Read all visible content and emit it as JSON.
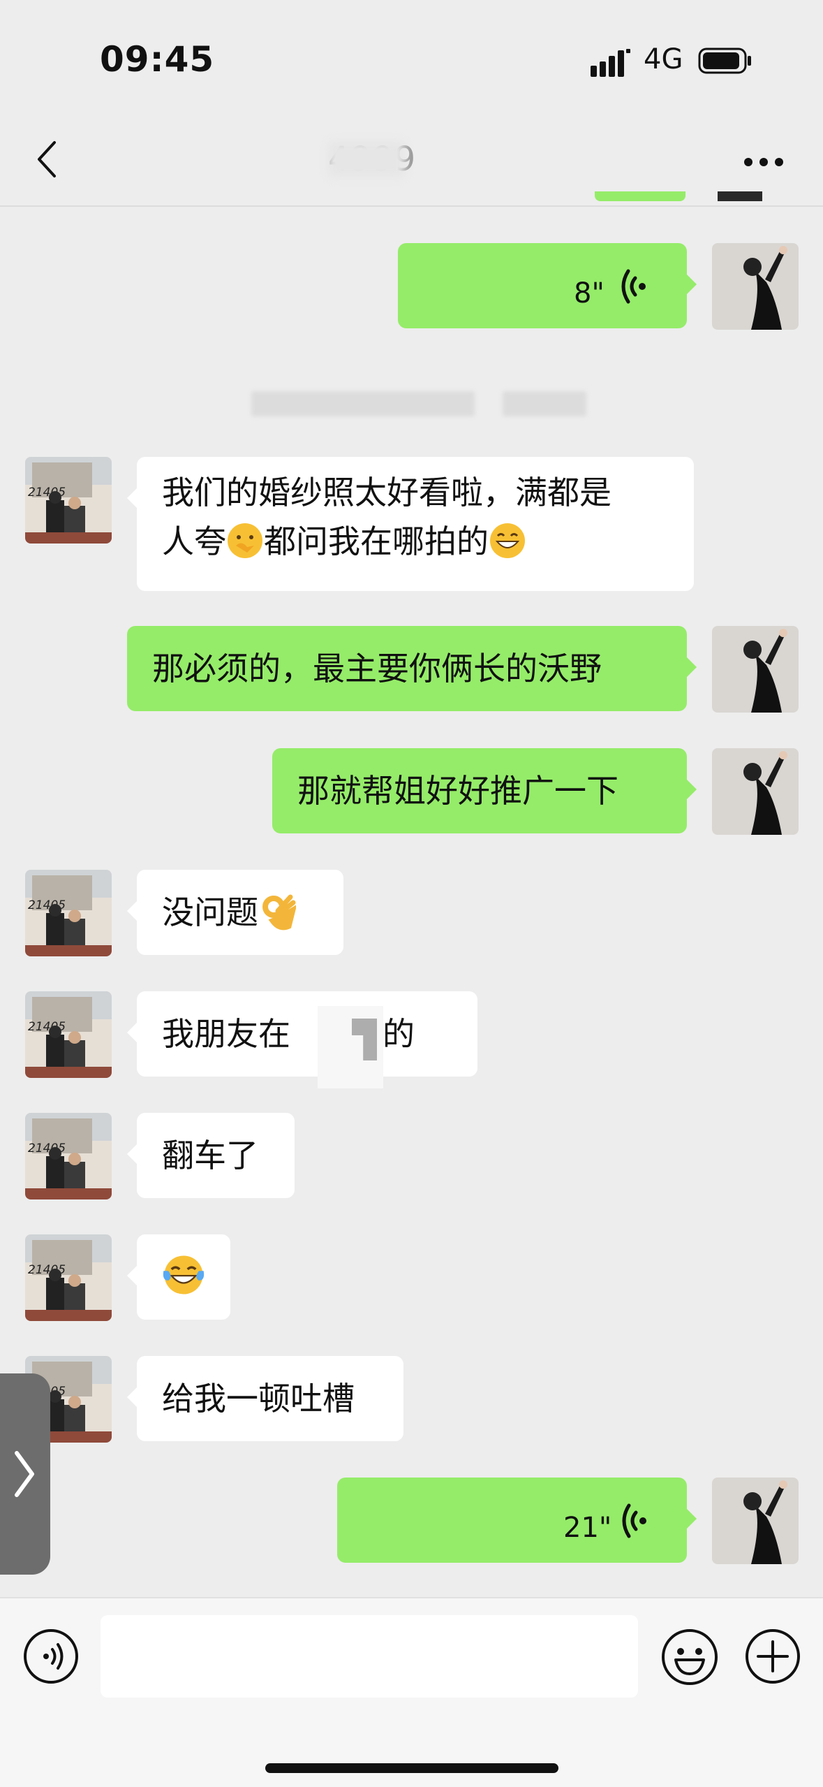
{
  "status_bar": {
    "time": "09:45",
    "network": "4G"
  },
  "header": {
    "title": "4999"
  },
  "timestamp": "",
  "messages": [
    {
      "side": "out",
      "type": "voice",
      "duration": "8\""
    },
    {
      "side": "in",
      "type": "text",
      "line1": "我们的婚纱照太好看啦，满都是",
      "line2_a": "人夸",
      "emoji1": "thinking-face-emoji",
      "line2_b": "都问我在哪拍的",
      "emoji2": "grinning-face-emoji"
    },
    {
      "side": "out",
      "type": "text",
      "text": "那必须的，最主要你俩长的沃野"
    },
    {
      "side": "out",
      "type": "text",
      "text": "那就帮姐好好推广一下"
    },
    {
      "side": "in",
      "type": "text",
      "text": "没问题",
      "emoji": "ok-hand-emoji"
    },
    {
      "side": "in",
      "type": "text",
      "text_a": "我朋友在",
      "text_b": "拍的"
    },
    {
      "side": "in",
      "type": "text",
      "text": "翻车了"
    },
    {
      "side": "in",
      "type": "emoji",
      "emoji": "tears-of-joy-emoji"
    },
    {
      "side": "in",
      "type": "text",
      "text": "给我一顿吐槽"
    },
    {
      "side": "out",
      "type": "voice",
      "duration": "21\""
    }
  ],
  "colors": {
    "background": "#ededed",
    "outgoing_bubble": "#95ec69",
    "incoming_bubble": "#ffffff"
  },
  "icons": [
    "back-icon",
    "more-icon",
    "voice-icon",
    "voice-toggle-icon",
    "emoji-icon",
    "plus-icon",
    "chevron-right-icon"
  ]
}
